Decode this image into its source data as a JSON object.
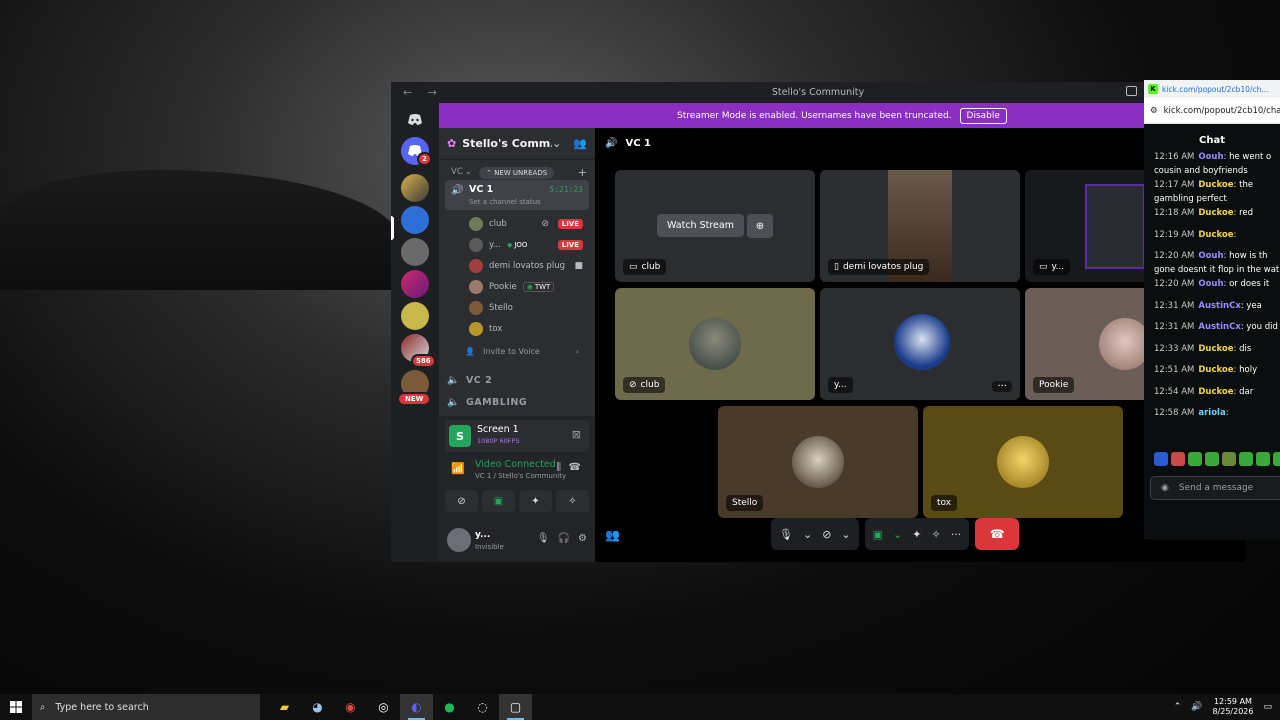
{
  "window": {
    "title": "Stello's Community"
  },
  "banner": {
    "text": "Streamer Mode is enabled. Usernames have been truncated.",
    "button": "Disable"
  },
  "rail": {
    "badges": {
      "home": "2",
      "a": "586",
      "new": "NEW"
    }
  },
  "server": {
    "name": "Stello's Comm..."
  },
  "channels": {
    "category": "VC",
    "new_unreads": "NEW UNREADS",
    "active": {
      "name": "VC 1",
      "time": "5:21:23",
      "status": "Set a channel status"
    },
    "members": [
      {
        "name": "club",
        "live": "LIVE"
      },
      {
        "name": "y...",
        "tag": "JOO",
        "live": "LIVE"
      },
      {
        "name": "demi lovatos plug"
      },
      {
        "name": "Pookie",
        "tag": "TWT"
      },
      {
        "name": "Stello"
      },
      {
        "name": "tox"
      }
    ],
    "invite": "Invite to Voice",
    "vc2": "VC 2",
    "gambling": "GAMBLING"
  },
  "panel": {
    "screen_title": "Screen 1",
    "screen_sub": "1080P 60FPS",
    "connected": "Video Connected",
    "connected_sub": "VC 1 / Stello's Community",
    "user_name": "y...",
    "user_status": "Invisible"
  },
  "stage": {
    "header": "VC 1",
    "watch_stream": "Watch Stream",
    "tiles": {
      "t1": "club",
      "t2": "demi lovatos plug",
      "t3": "y...",
      "t4": "club",
      "t5": "y...",
      "t6": "Pookie",
      "t7": "Stello",
      "t8": "tox"
    }
  },
  "kick": {
    "tab_url": "kick.com/popout/2cb10/ch...",
    "address": "kick.com/popout/2cb10/cha",
    "header": "Chat",
    "messages": [
      {
        "time": "12:16 AM",
        "user": "Oouh",
        "color": "#9b8cff",
        "body": "he went o"
      },
      {
        "time": "",
        "user": "",
        "color": "#fff",
        "body": "cousin and boyfriends"
      },
      {
        "time": "12:17 AM",
        "user": "Duckoe",
        "color": "#f5d442",
        "body": "the"
      },
      {
        "time": "",
        "user": "",
        "color": "#fff",
        "body": "gambling perfect"
      },
      {
        "time": "12:18 AM",
        "user": "Duckoe",
        "color": "#f5d442",
        "body": "red"
      },
      {
        "time": "12:19 AM",
        "user": "Duckoe",
        "color": "#f5d442",
        "body": ""
      },
      {
        "time": "12:20 AM",
        "user": "Oouh",
        "color": "#9b8cff",
        "body": "how is th"
      },
      {
        "time": "",
        "user": "",
        "color": "#fff",
        "body": "gone doesnt it flop in the wat"
      },
      {
        "time": "12:20 AM",
        "user": "Oouh",
        "color": "#9b8cff",
        "body": "or does it"
      },
      {
        "time": "12:31 AM",
        "user": "AustinCx",
        "color": "#9b8cff",
        "body": "yea"
      },
      {
        "time": "12:31 AM",
        "user": "AustinCx",
        "color": "#9b8cff",
        "body": "you did"
      },
      {
        "time": "12:33 AM",
        "user": "Duckoe",
        "color": "#f5d442",
        "body": "dis"
      },
      {
        "time": "12:51 AM",
        "user": "Duckoe",
        "color": "#f5d442",
        "body": "holy"
      },
      {
        "time": "12:54 AM",
        "user": "Duckoe",
        "color": "#f5d442",
        "body": "dar"
      },
      {
        "time": "12:58 AM",
        "user": "ariola",
        "color": "#6fd3ff",
        "body": ""
      }
    ],
    "send_placeholder": "Send a message"
  },
  "taskbar": {
    "search": "Type here to search",
    "time": "12:59 AM",
    "date": "8/25/2026"
  }
}
